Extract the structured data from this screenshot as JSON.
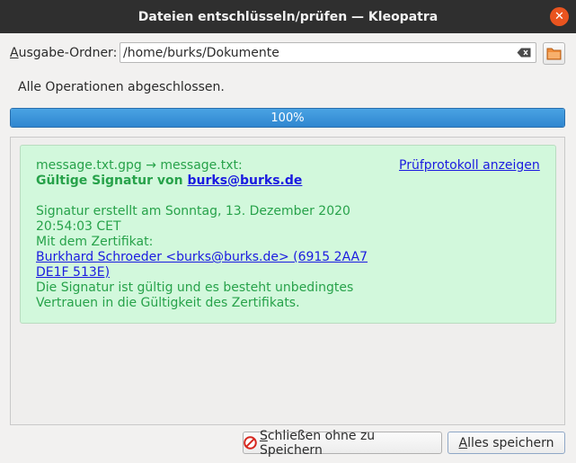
{
  "window": {
    "title": "Dateien entschlüsseln/prüfen — Kleopatra",
    "close_glyph": "✕"
  },
  "output": {
    "label_mnemonic": "A",
    "label_rest": "usgabe-Ordner:",
    "value": "/home/burks/Dokumente"
  },
  "status": {
    "text": "Alle Operationen abgeschlossen."
  },
  "progress": {
    "percent": 100,
    "label": "100%"
  },
  "result": {
    "files": "message.txt.gpg → message.txt:",
    "valid_prefix": "Gültige Signatur von ",
    "signer_email": "burks@burks.de",
    "created_line1": "Signatur erstellt am Sonntag, 13. Dezember 2020",
    "created_line2": "20:54:03 CET",
    "cert_label": "Mit dem Zertifikat:",
    "cert_link_line1": "Burkhard Schroeder <burks@burks.de> (6915 2AA7",
    "cert_link_line2": "DE1F 513E)",
    "trust_line1": "Die Signatur ist gültig und es besteht unbedingtes",
    "trust_line2": "Vertrauen in die Gültigkeit des Zertifikats.",
    "audit_link": "Prüfprotokoll anzeigen"
  },
  "buttons": {
    "close_mnemonic": "S",
    "close_rest": "chließen ohne zu Speichern",
    "save_mnemonic": "A",
    "save_rest": "lles speichern"
  },
  "icons": {
    "clear": "clear-input-icon",
    "folder": "folder-icon",
    "stop": "stop-icon"
  },
  "colors": {
    "success_green": "#27a24a",
    "success_bg": "#d2f8dc",
    "link_blue": "#1a1ae0",
    "progress_blue": "#3a93d9",
    "close_orange": "#e9541f"
  }
}
